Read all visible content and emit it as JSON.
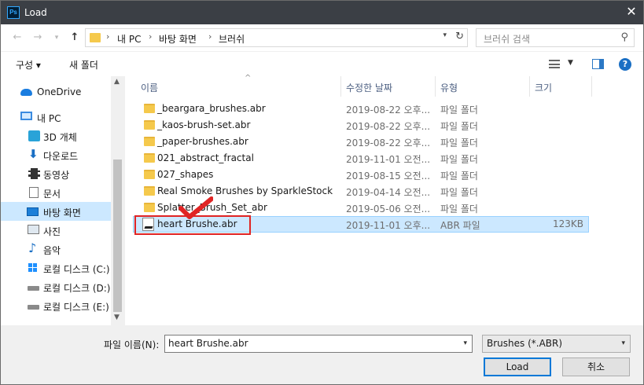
{
  "window": {
    "title": "Load",
    "app_icon": "Ps"
  },
  "address": {
    "crumbs": [
      "내 PC",
      "바탕 화면",
      "브러쉬"
    ],
    "search_placeholder": "브러쉬 검색"
  },
  "toolbar": {
    "organize": "구성 ▾",
    "new_folder": "새 폴더",
    "help": "?"
  },
  "nav": [
    {
      "label": "OneDrive",
      "icon": "onedrive-icon"
    },
    {
      "label": "내 PC",
      "icon": "pc-icon"
    },
    {
      "label": "3D 개체",
      "icon": "3d-objects-icon"
    },
    {
      "label": "다운로드",
      "icon": "download-icon"
    },
    {
      "label": "동영상",
      "icon": "video-icon"
    },
    {
      "label": "문서",
      "icon": "documents-icon"
    },
    {
      "label": "바탕 화면",
      "icon": "desktop-icon",
      "selected": true
    },
    {
      "label": "사진",
      "icon": "pictures-icon"
    },
    {
      "label": "음악",
      "icon": "music-icon"
    },
    {
      "label": "로컬 디스크 (C:)",
      "icon": "windows-drive-icon"
    },
    {
      "label": "로컬 디스크 (D:)",
      "icon": "drive-icon"
    },
    {
      "label": "로컬 디스크 (E:)",
      "icon": "drive-icon"
    }
  ],
  "columns": {
    "name": "이름",
    "date": "수정한 날짜",
    "type": "유형",
    "size": "크기"
  },
  "files": [
    {
      "name": "_beargara_brushes.abr",
      "date": "2019-08-22 오후...",
      "type": "파일 폴더",
      "size": "",
      "kind": "folder"
    },
    {
      "name": "_kaos-brush-set.abr",
      "date": "2019-08-22 오후...",
      "type": "파일 폴더",
      "size": "",
      "kind": "folder"
    },
    {
      "name": "_paper-brushes.abr",
      "date": "2019-08-22 오후...",
      "type": "파일 폴더",
      "size": "",
      "kind": "folder"
    },
    {
      "name": "021_abstract_fractal",
      "date": "2019-11-01 오전...",
      "type": "파일 폴더",
      "size": "",
      "kind": "folder"
    },
    {
      "name": "027_shapes",
      "date": "2019-08-15 오전...",
      "type": "파일 폴더",
      "size": "",
      "kind": "folder"
    },
    {
      "name": "Real Smoke Brushes by SparkleStock",
      "date": "2019-04-14 오전...",
      "type": "파일 폴더",
      "size": "",
      "kind": "folder"
    },
    {
      "name": "Splatter_Brush_Set_abr",
      "date": "2019-05-06 오전...",
      "type": "파일 폴더",
      "size": "",
      "kind": "folder"
    },
    {
      "name": "heart Brushe.abr",
      "date": "2019-11-01 오후...",
      "type": "ABR 파일",
      "size": "123KB",
      "kind": "abr",
      "selected": true
    }
  ],
  "filename": {
    "label": "파일 이름(N):",
    "value": "heart Brushe.abr"
  },
  "filter": {
    "value": "Brushes (*.ABR)"
  },
  "buttons": {
    "load": "Load",
    "cancel": "취소"
  },
  "colors": {
    "title_bar": "#3b3f45",
    "selection": "#cce8ff",
    "highlight_red": "#e02424",
    "accent": "#0078d7"
  }
}
